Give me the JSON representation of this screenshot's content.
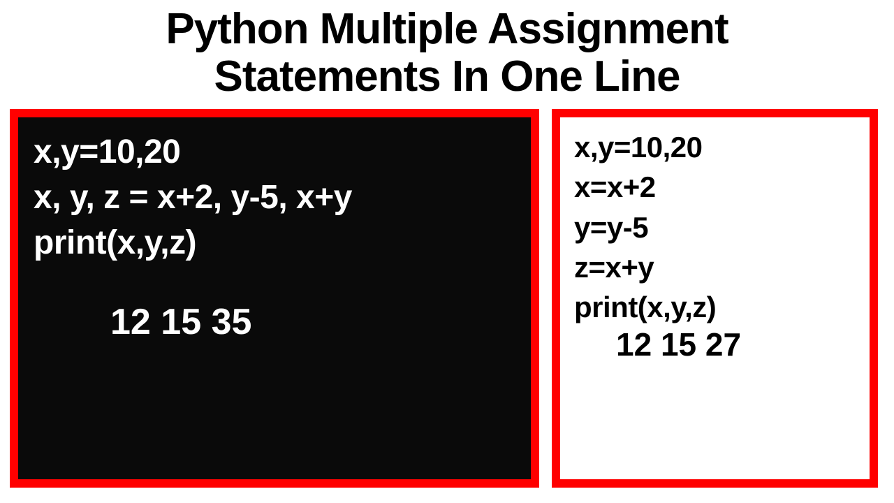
{
  "title_line1": "Python Multiple Assignment",
  "title_line2": "Statements In One Line",
  "left_panel": {
    "line1": "x,y=10,20",
    "line2": "x, y, z = x+2, y-5, x+y",
    "line3": "print(x,y,z)",
    "output": "12 15 35"
  },
  "right_panel": {
    "line1": "x,y=10,20",
    "line2": "x=x+2",
    "line3": "y=y-5",
    "line4": "z=x+y",
    "line5": "print(x,y,z)",
    "output": "12 15 27"
  }
}
